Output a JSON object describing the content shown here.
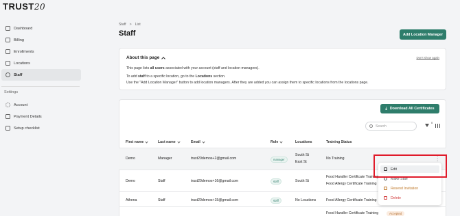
{
  "brand": {
    "logo_text": "TRUST",
    "logo_script": "20"
  },
  "sidebar": {
    "items": [
      {
        "label": "Dashboard",
        "icon": "home-icon"
      },
      {
        "label": "Billing",
        "icon": "card-icon"
      },
      {
        "label": "Enrollments",
        "icon": "layers-icon"
      },
      {
        "label": "Locations",
        "icon": "map-icon"
      },
      {
        "label": "Staff",
        "icon": "users-icon",
        "active": true
      }
    ],
    "settings_label": "Settings",
    "settings_items": [
      {
        "label": "Account",
        "icon": "user-icon"
      },
      {
        "label": "Payment Details",
        "icon": "wallet-icon"
      },
      {
        "label": "Setup checklist",
        "icon": "checklist-icon"
      }
    ]
  },
  "breadcrumb": {
    "first": "Staff",
    "sep": ">",
    "second": "List"
  },
  "page": {
    "title": "Staff",
    "add_button": "Add Location Manager"
  },
  "about": {
    "title": "About this page",
    "dont_show": "Don't show again",
    "line1_prefix": "This page lists ",
    "line1_bold": "all users",
    "line1_suffix": " associated with your account (staff and location managers).",
    "line2_prefix": "To add ",
    "line2_bold1": "staff",
    "line2_mid": " to a specific location, go to the ",
    "line2_bold2": "Locations",
    "line2_suffix": " section.",
    "line3": "Use the \"Add Location Manager\" button to add location managers. After they are added you can assign them to specific locations from the locations page."
  },
  "table": {
    "download_button": "Download All Certificates",
    "search_placeholder": "Search",
    "filter_count": "0",
    "columns": [
      "First name",
      "Last name",
      "Email",
      "Role",
      "Locations",
      "Training Status"
    ],
    "rows": [
      {
        "first": "Demo",
        "last": "Manager",
        "email": "trust20demos+2@gmail.com",
        "role": "manager",
        "locations": [
          "South St",
          "East St"
        ],
        "training": [
          "No Training"
        ]
      },
      {
        "first": "Demo",
        "last": "Staff",
        "email": "trust20demos+16@gmail.com",
        "role": "staff",
        "locations": [
          "South St"
        ],
        "training": [
          "Food Handler Certificate Training",
          "Food Allergy Certificate Training"
        ]
      },
      {
        "first": "Athena",
        "last": "Staff",
        "email": "trust20demos+15@gmail.com",
        "role": "staff",
        "locations": [
          "No Locations"
        ],
        "training": [
          "Food Allergy Certificate Training"
        ]
      },
      {
        "training": [
          "Food Handler Certificate Training"
        ],
        "status_badge": "Accepted"
      }
    ]
  },
  "menu": {
    "items": [
      {
        "label": "Edit",
        "color": "#333333"
      },
      {
        "label": "Make Staff",
        "color": "#555555"
      },
      {
        "label": "Resend Invitation",
        "color": "#c07a2c"
      },
      {
        "label": "Delete",
        "color": "#d23c3c"
      }
    ]
  },
  "colors": {
    "accent": "#2e7d6b",
    "highlight": "#e01b2a"
  }
}
